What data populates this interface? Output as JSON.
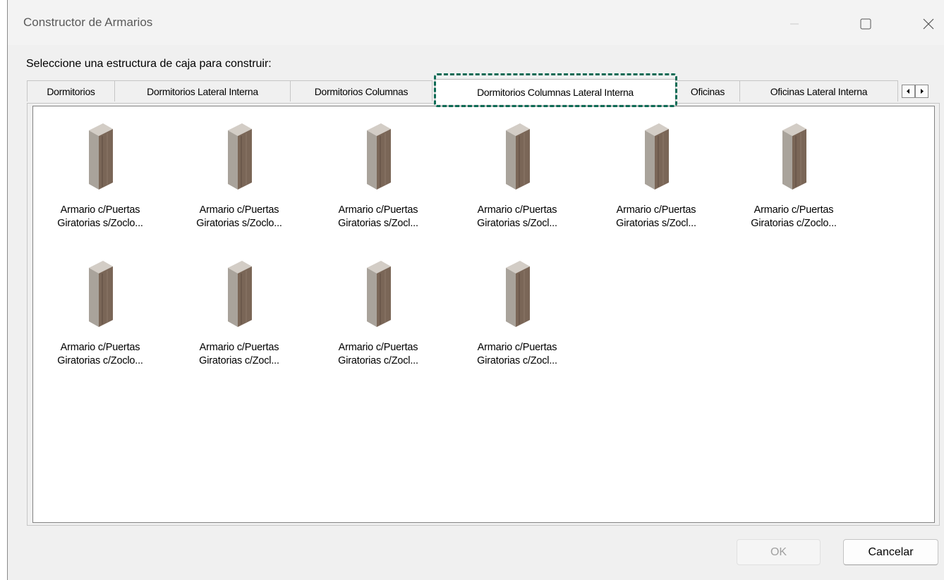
{
  "window": {
    "title": "Constructor de Armarios",
    "accent_color": "#0e6b55"
  },
  "prompt": "Seleccione una estructura de caja para construir:",
  "tabs": [
    {
      "label": "Dormitorios",
      "active": false
    },
    {
      "label": "Dormitorios Lateral Interna",
      "active": false
    },
    {
      "label": "Dormitorios Columnas",
      "active": false
    },
    {
      "label": "Dormitorios Columnas Lateral Interna",
      "active": true
    },
    {
      "label": "Oficinas",
      "active": false
    },
    {
      "label": "Oficinas Lateral Interna",
      "active": false
    }
  ],
  "items": [
    {
      "line1": "Armario c/Puertas",
      "line2": "Giratorias s/Zoclo..."
    },
    {
      "line1": "Armario c/Puertas",
      "line2": "Giratorias s/Zoclo..."
    },
    {
      "line1": "Armario c/Puertas",
      "line2": "Giratorias s/Zocl..."
    },
    {
      "line1": "Armario c/Puertas",
      "line2": "Giratorias s/Zocl..."
    },
    {
      "line1": "Armario c/Puertas",
      "line2": "Giratorias s/Zocl..."
    },
    {
      "line1": "Armario c/Puertas",
      "line2": "Giratorias c/Zoclo..."
    },
    {
      "line1": "Armario c/Puertas",
      "line2": "Giratorias c/Zoclo..."
    },
    {
      "line1": "Armario c/Puertas",
      "line2": "Giratorias c/Zocl..."
    },
    {
      "line1": "Armario c/Puertas",
      "line2": "Giratorias c/Zocl..."
    },
    {
      "line1": "Armario c/Puertas",
      "line2": "Giratorias c/Zocl..."
    }
  ],
  "buttons": {
    "ok": "OK",
    "cancel": "Cancelar"
  }
}
